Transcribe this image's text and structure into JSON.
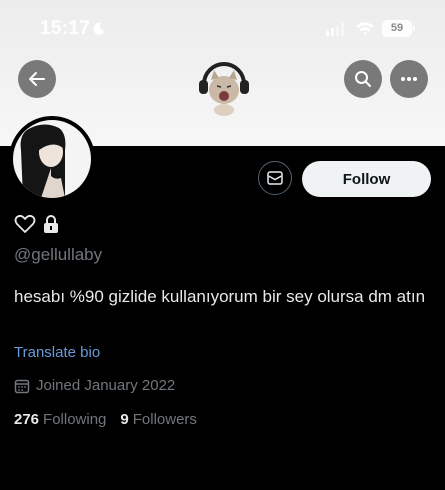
{
  "status_bar": {
    "time": "15:17",
    "battery": "59"
  },
  "header": {
    "back_icon": "arrow-left-icon",
    "search_icon": "search-icon",
    "more_icon": "ellipsis-icon",
    "banner_image": "cat-with-headphones"
  },
  "profile": {
    "handle": "@gellullaby",
    "bio": "hesabı %90 gizlide kullanıyorum bir sey olursa dm atın",
    "translate_label": "Translate bio",
    "joined": "Joined January 2022",
    "following_count": "276",
    "following_label": "Following",
    "followers_count": "9",
    "followers_label": "Followers",
    "follow_label": "Follow"
  },
  "colors": {
    "background": "#000000",
    "link": "#6a9bd8",
    "muted": "#71767b"
  }
}
